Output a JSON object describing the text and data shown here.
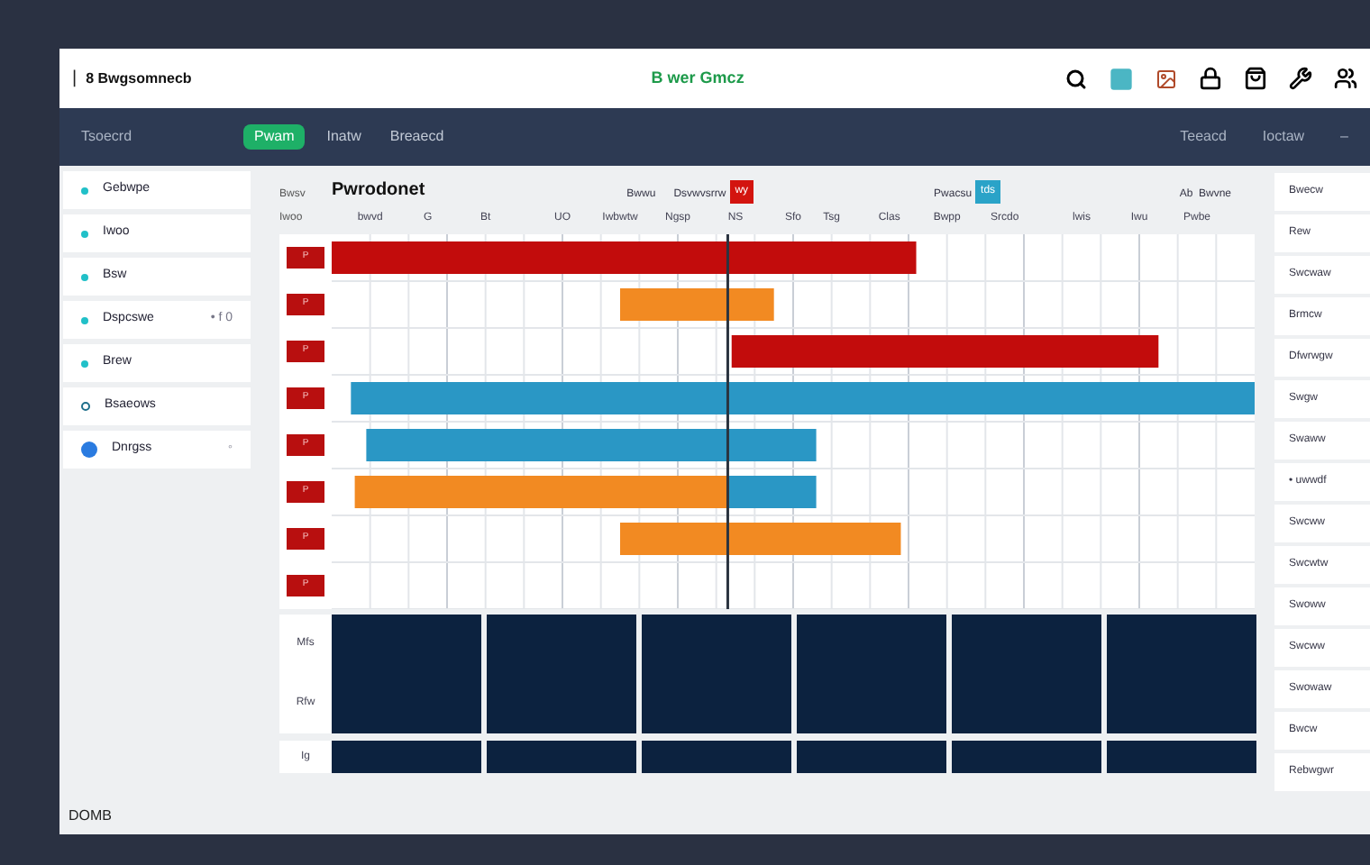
{
  "top_bar": {
    "mark": "|",
    "title": "8 Bwgsomnecb",
    "center_title": "B wer Gmcz"
  },
  "nav": {
    "left": "Tsoecrd",
    "items": [
      {
        "label": "Pwam",
        "selected": true
      },
      {
        "label": "Inatw",
        "selected": false
      },
      {
        "label": "Breaecd",
        "selected": false
      }
    ],
    "right": [
      "Teeacd",
      "Ioctaw",
      "–"
    ]
  },
  "sidebar": {
    "items": [
      {
        "label": "Gebwpe",
        "kind": "dot"
      },
      {
        "label": "Iwoo",
        "kind": "dot"
      },
      {
        "label": "Bsw",
        "kind": "dot"
      },
      {
        "label": "Dspcswe",
        "kind": "dot",
        "suffix": "• f 0"
      },
      {
        "label": "Brew",
        "kind": "dot"
      },
      {
        "label": "Bsaeows",
        "kind": "ring"
      },
      {
        "label": "Dnrgss",
        "kind": "avatar",
        "suffix": "◦"
      }
    ]
  },
  "gantt": {
    "title": "Pwrodonet",
    "row_head": [
      "Bwsv",
      "Iwoo"
    ],
    "header_notes": [
      {
        "label": "Bwwu"
      },
      {
        "label": "Dsvwvsrrw",
        "badge": "wy"
      },
      {
        "label": "Pwacsu",
        "badge": "tds"
      }
    ],
    "right_note": "Ab  Bwvne",
    "columns": [
      "bwvd",
      "G",
      "Bt",
      "UO",
      "Iwbwtw",
      "Ngsp",
      "NS",
      "Sfo",
      "Tsg",
      "Clas",
      "Bwpp",
      "Srcdo",
      "lwis",
      "Iwu",
      "Pwbe"
    ],
    "rows": [
      {
        "tag": "P",
        "bars": [
          {
            "color": "#c20c0c"
          }
        ]
      },
      {
        "tag": "P",
        "bars": [
          {
            "color": "#f28a22"
          }
        ]
      },
      {
        "tag": "P",
        "bars": [
          {
            "color": "#c20c0c"
          }
        ]
      },
      {
        "tag": "P",
        "bars": [
          {
            "color": "#2a97c5"
          }
        ]
      },
      {
        "tag": "P",
        "bars": [
          {
            "color": "#2a97c5"
          }
        ]
      },
      {
        "tag": "P",
        "bars": [
          {
            "color": "#f28a22"
          },
          {
            "color": "#2a97c5"
          }
        ]
      },
      {
        "tag": "P",
        "bars": [
          {
            "color": "#f28a22"
          }
        ]
      },
      {
        "tag": "P"
      }
    ],
    "block_rows": [
      {
        "label": "Mfs"
      },
      {
        "label": "Rfw"
      },
      {
        "label": "Ig"
      }
    ]
  },
  "right_list": [
    "Bwecw",
    "Rew",
    "Swcwaw",
    "Brmcw",
    "Dfwrwgw",
    "Swgw",
    "Swaww",
    "• uwwdf",
    "Swcww",
    "Swcwtw",
    "Swoww",
    "Swcww",
    "Swowaw",
    "Bwcw",
    "Rebwgwr"
  ],
  "status_bar": "DOMB"
}
